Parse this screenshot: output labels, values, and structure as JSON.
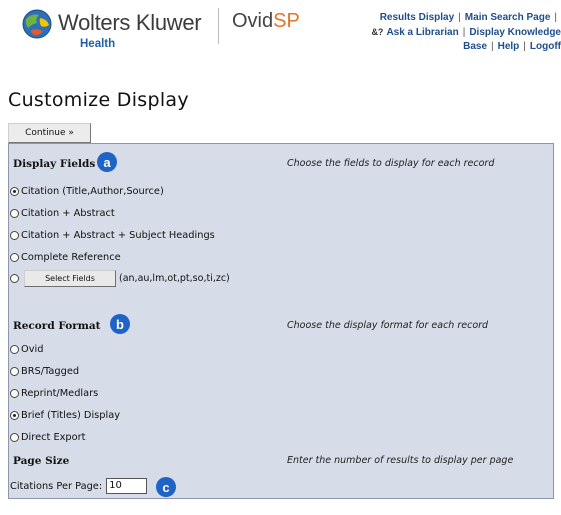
{
  "brand": {
    "company": "Wolters Kluwer",
    "division": "Health",
    "product_main": "Ovid",
    "product_suffix": "SP",
    "colors": {
      "link_blue": "#1f4e8c",
      "sp_orange": "#e3742a",
      "badge_blue": "#1f63c6",
      "panel_bg": "#d6dce8"
    }
  },
  "toplinks": {
    "results_display": "Results Display",
    "main_search_page": "Main Search Page",
    "ask_icon": "&?",
    "ask_librarian": "Ask a Librarian",
    "display_knowledge": "Display Knowledge",
    "base": "Base",
    "help": "Help",
    "logoff": "Logoff",
    "separator": "|"
  },
  "page": {
    "title": "Customize Display",
    "continue_label": "Continue »"
  },
  "display_fields": {
    "header": "Display Fields",
    "badge": "a",
    "description": "Choose the fields to display for each record",
    "options": [
      {
        "label": "Citation (Title,Author,Source)",
        "selected": true
      },
      {
        "label": "Citation + Abstract",
        "selected": false
      },
      {
        "label": "Citation + Abstract + Subject Headings",
        "selected": false
      },
      {
        "label": "Complete Reference",
        "selected": false
      }
    ],
    "select_fields_label": "Select Fields",
    "select_fields_hint": "(an,au,lm,ot,pt,so,ti,zc)"
  },
  "record_format": {
    "header": "Record Format",
    "badge": "b",
    "description": "Choose the display format for each record",
    "options": [
      {
        "label": "Ovid",
        "selected": false
      },
      {
        "label": "BRS/Tagged",
        "selected": false
      },
      {
        "label": "Reprint/Medlars",
        "selected": false
      },
      {
        "label": "Brief (Titles) Display",
        "selected": true
      },
      {
        "label": "Direct Export",
        "selected": false
      }
    ]
  },
  "page_size": {
    "header": "Page Size",
    "badge": "c",
    "description": "Enter the number of results to display per page",
    "field_label": "Citations Per Page:",
    "value": "10"
  }
}
